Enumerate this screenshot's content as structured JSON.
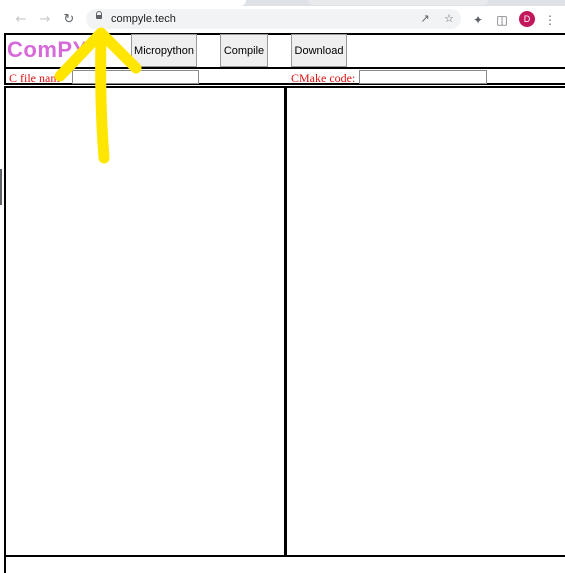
{
  "browser": {
    "url": "compyle.tech",
    "nav": {
      "back": "back-icon",
      "forward": "forward-icon",
      "reload": "reload-icon"
    },
    "icons": [
      "share-icon",
      "star-icon",
      "extensions-icon",
      "sidepanel-icon",
      "menu-icon"
    ],
    "profile_initial": "D",
    "profile_color": "#c2185b"
  },
  "app": {
    "logo": "ComPY",
    "buttons": {
      "micropython": "Micropython",
      "compile": "Compile",
      "download": "Download"
    },
    "c_file_label": "C file nam",
    "cmake_label": "CMake code:",
    "c_file_value": "",
    "cmake_value": "",
    "logo_color": "#d66ad8",
    "label_color": "#e01010"
  },
  "annotation": {
    "arrow_color": "#ffe600"
  }
}
